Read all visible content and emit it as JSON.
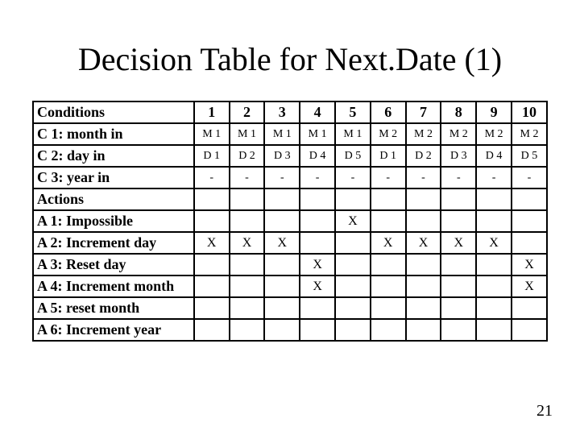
{
  "title": "Decision Table for Next.Date (1)",
  "page_number": "21",
  "headers": {
    "conditions": "Conditions",
    "cols": [
      "1",
      "2",
      "3",
      "4",
      "5",
      "6",
      "7",
      "8",
      "9",
      "10"
    ],
    "actions": "Actions"
  },
  "conditions": [
    {
      "label": "C 1: month in",
      "vals": [
        "M 1",
        "M 1",
        "M 1",
        "M 1",
        "M 1",
        "M 2",
        "M 2",
        "M 2",
        "M 2",
        "M 2"
      ]
    },
    {
      "label": "C 2: day in",
      "vals": [
        "D 1",
        "D 2",
        "D 3",
        "D 4",
        "D 5",
        "D 1",
        "D 2",
        "D 3",
        "D 4",
        "D 5"
      ]
    },
    {
      "label": "C 3: year in",
      "vals": [
        "-",
        "-",
        "-",
        "-",
        "-",
        "-",
        "-",
        "-",
        "-",
        "-"
      ]
    }
  ],
  "actions": [
    {
      "label": "A 1: Impossible",
      "vals": [
        "",
        "",
        "",
        "",
        "X",
        "",
        "",
        "",
        "",
        ""
      ]
    },
    {
      "label": "A 2: Increment day",
      "vals": [
        "X",
        "X",
        "X",
        "",
        "",
        "X",
        "X",
        "X",
        "X",
        ""
      ]
    },
    {
      "label": "A 3: Reset day",
      "vals": [
        "",
        "",
        "",
        "X",
        "",
        "",
        "",
        "",
        "",
        "X"
      ]
    },
    {
      "label": "A 4: Increment month",
      "vals": [
        "",
        "",
        "",
        "X",
        "",
        "",
        "",
        "",
        "",
        "X"
      ]
    },
    {
      "label": "A 5: reset month",
      "vals": [
        "",
        "",
        "",
        "",
        "",
        "",
        "",
        "",
        "",
        ""
      ]
    },
    {
      "label": "A 6: Increment year",
      "vals": [
        "",
        "",
        "",
        "",
        "",
        "",
        "",
        "",
        "",
        ""
      ]
    }
  ],
  "chart_data": {
    "type": "table",
    "title": "Decision Table for Next.Date (1)",
    "columns": [
      "1",
      "2",
      "3",
      "4",
      "5",
      "6",
      "7",
      "8",
      "9",
      "10"
    ],
    "conditions": {
      "C 1: month in": [
        "M 1",
        "M 1",
        "M 1",
        "M 1",
        "M 1",
        "M 2",
        "M 2",
        "M 2",
        "M 2",
        "M 2"
      ],
      "C 2: day in": [
        "D 1",
        "D 2",
        "D 3",
        "D 4",
        "D 5",
        "D 1",
        "D 2",
        "D 3",
        "D 4",
        "D 5"
      ],
      "C 3: year in": [
        "-",
        "-",
        "-",
        "-",
        "-",
        "-",
        "-",
        "-",
        "-",
        "-"
      ]
    },
    "actions": {
      "A 1: Impossible": [
        "",
        "",
        "",
        "",
        "X",
        "",
        "",
        "",
        "",
        ""
      ],
      "A 2: Increment day": [
        "X",
        "X",
        "X",
        "",
        "",
        "X",
        "X",
        "X",
        "X",
        ""
      ],
      "A 3: Reset day": [
        "",
        "",
        "",
        "X",
        "",
        "",
        "",
        "",
        "",
        "X"
      ],
      "A 4: Increment month": [
        "",
        "",
        "",
        "X",
        "",
        "",
        "",
        "",
        "",
        "X"
      ],
      "A 5: reset month": [
        "",
        "",
        "",
        "",
        "",
        "",
        "",
        "",
        "",
        ""
      ],
      "A 6: Increment year": [
        "",
        "",
        "",
        "",
        "",
        "",
        "",
        "",
        "",
        ""
      ]
    }
  }
}
